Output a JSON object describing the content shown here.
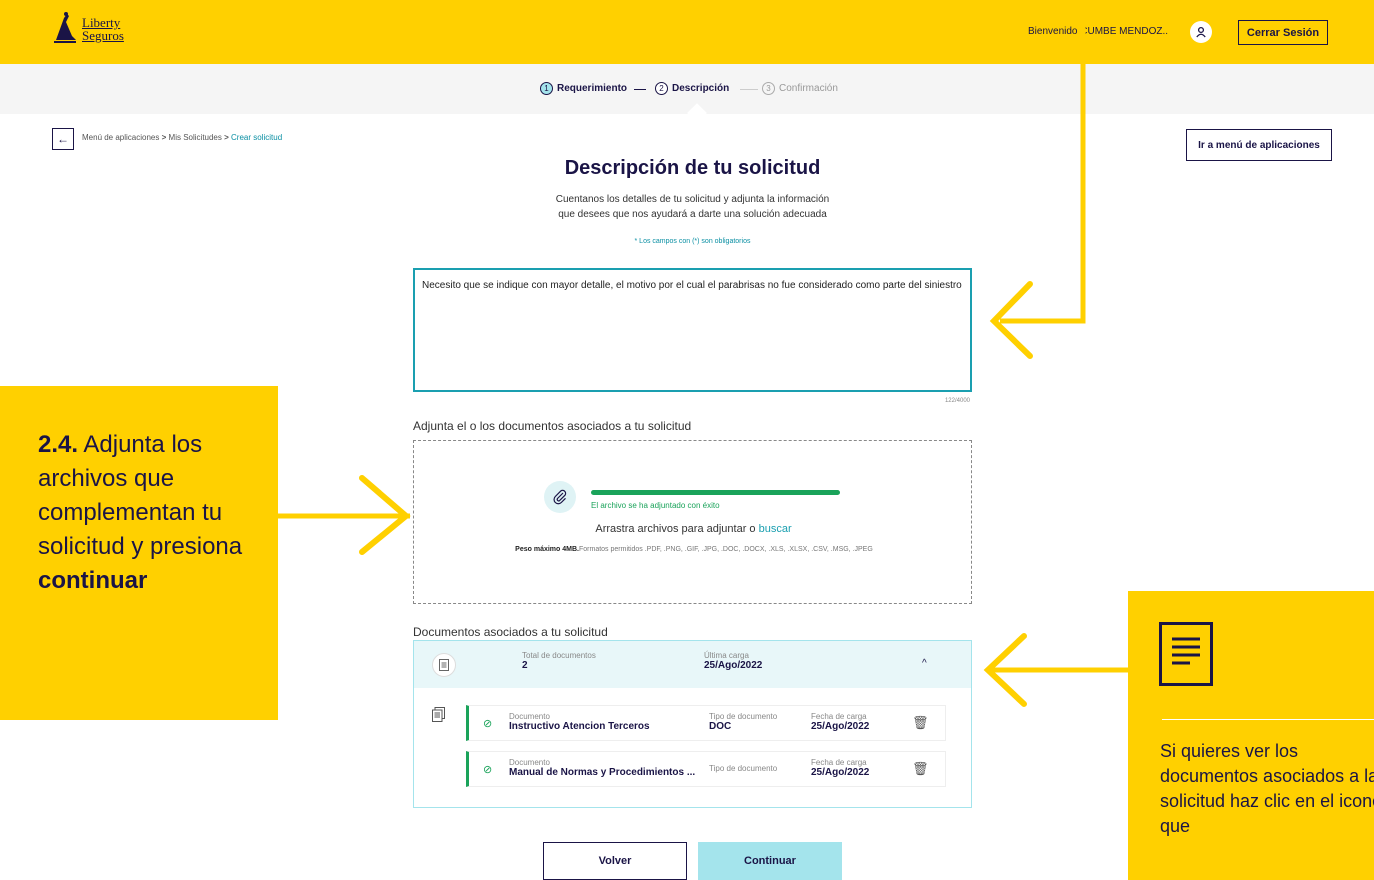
{
  "brand": {
    "line1": "Liberty",
    "line2": "Seguros"
  },
  "header": {
    "welcome": "Bienvenido CUMBE MENDOZ...",
    "logout": "Cerrar Sesión"
  },
  "steps": [
    {
      "num": "1",
      "label": "Requerimiento"
    },
    {
      "num": "2",
      "label": "Descripción"
    },
    {
      "num": "3",
      "label": "Confirmación"
    }
  ],
  "breadcrumb": {
    "items": [
      "Menú de aplicaciones",
      "Mis Solicitudes",
      "Crear solicitud"
    ],
    "sep": ">"
  },
  "menu_button": "Ir a menú de aplicaciones",
  "title": "Descripción de tu solicitud",
  "subtitle_1": "Cuentanos los detalles de tu solicitud y adjunta la información",
  "subtitle_2": "que desees que nos ayudará a darte una solución adecuada",
  "required_note": "* Los campos con (*) son obligatorios",
  "description_value": "Necesito que se indique con mayor detalle, el motivo por el cual el parabrisas no fue considerado como parte del siniestro",
  "counter": "122/4000",
  "attach": {
    "title": "Adjunta el o los documentos asociados a tu solicitud",
    "progress": 1.0,
    "success": "El archivo se ha adjuntado con éxito",
    "drag_text": "Arrastra archivos para adjuntar o",
    "drag_link": "buscar",
    "max_size": "Peso máximo 4MB.",
    "formats": "Formatos permitidos .PDF, .PNG, .GIF, .JPG, .DOC, .DOCX, .XLS, .XLSX, .CSV, .MSG, .JPEG"
  },
  "docs": {
    "title": "Documentos asociados a tu solicitud",
    "total_label": "Total de documentos",
    "total_value": "2",
    "last_label": "Última carga",
    "last_value": "25/Ago/2022",
    "rows": [
      {
        "doc_label": "Documento",
        "doc_value": "Instructivo Atencion Terceros",
        "type_label": "Tipo de documento",
        "type_value": "DOC",
        "date_label": "Fecha de carga",
        "date_value": "25/Ago/2022"
      },
      {
        "doc_label": "Documento",
        "doc_value": "Manual de Normas y Procedimientos ...",
        "type_label": "Tipo de documento",
        "type_value": "",
        "date_label": "Fecha de carga",
        "date_value": "25/Ago/2022"
      }
    ]
  },
  "buttons": {
    "back": "Volver",
    "continue": "Continuar"
  },
  "callout_left": {
    "num": "2.4.",
    "text1": " Adjunta los archivos que complementan tu solicitud y presiona ",
    "bold": "continuar"
  },
  "callout_right": {
    "text": "Si quieres ver los documentos asociados a la solicitud haz clic en el icono que"
  },
  "colors": {
    "yellow": "#ffd000",
    "navy": "#1a1446",
    "teal": "#1a9fb0",
    "green": "#1aa35a",
    "light_teal": "#a4e4ec"
  },
  "icons": [
    "liberty-logo-icon",
    "user-icon",
    "arrow-left-icon",
    "paperclip-icon",
    "document-icon",
    "documents-stack-icon",
    "check-circle-icon",
    "trash-icon",
    "chevron-up-icon"
  ]
}
